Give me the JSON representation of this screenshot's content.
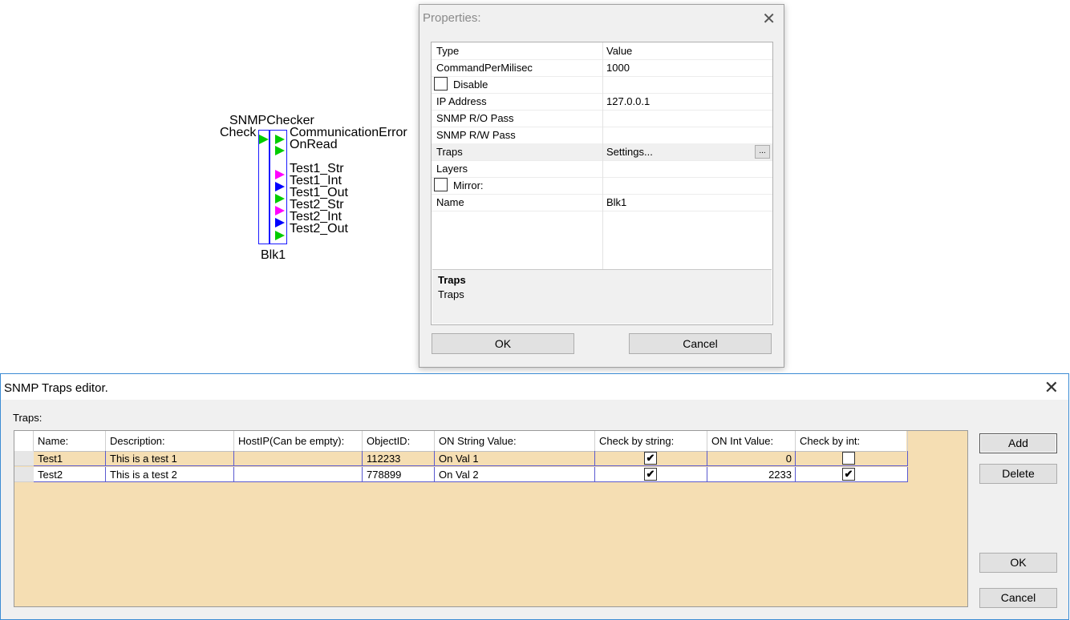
{
  "block": {
    "title": "SNMPChecker",
    "input": "Check",
    "name": "Blk1",
    "outputs": [
      {
        "label": "CommunicationError",
        "color": "#00cc00"
      },
      {
        "label": "OnRead",
        "color": "#00cc00"
      },
      {
        "label": "Test1_Str",
        "color": "#ff00ff"
      },
      {
        "label": "Test1_Int",
        "color": "#ff00ff"
      },
      {
        "label": "Test1_Out",
        "color": "#0000ff"
      },
      {
        "label": "Test2_Str",
        "color": "#00cc00"
      },
      {
        "label": "Test2_Int",
        "color": "#ff00ff"
      },
      {
        "label": "Test2_Out",
        "color": "#0000ff"
      }
    ]
  },
  "properties": {
    "title": "Properties:",
    "header_type": "Type",
    "header_value": "Value",
    "rows": [
      {
        "name": "CommandPerMilisec",
        "value": "1000"
      },
      {
        "name": "Disable",
        "value": "",
        "checkbox": true
      },
      {
        "name": "IP Address",
        "value": "127.0.0.1"
      },
      {
        "name": "SNMP R/O Pass",
        "value": ""
      },
      {
        "name": "SNMP R/W Pass",
        "value": ""
      },
      {
        "name": "Traps",
        "value": "Settings...",
        "ellipsis": "..."
      },
      {
        "name": "Layers",
        "value": ""
      },
      {
        "name": "Mirror:",
        "value": "",
        "checkbox": true
      },
      {
        "name": "Name",
        "value": "Blk1"
      }
    ],
    "description_title": "Traps",
    "description_text": "Traps",
    "ok_label": "OK",
    "cancel_label": "Cancel"
  },
  "traps_editor": {
    "title": "SNMP Traps editor.",
    "group_label": "Traps:",
    "columns": [
      "Name:",
      "Description:",
      "HostIP(Can be empty):",
      "ObjectID:",
      "ON String Value:",
      "Check by string:",
      "ON Int Value:",
      "Check by int:"
    ],
    "rows": [
      {
        "name": "Test1",
        "description": "This is a test 1",
        "host_ip": "",
        "object_id": "112233",
        "on_string": "On Val 1",
        "check_string": true,
        "on_int": "0",
        "check_int": false
      },
      {
        "name": "Test2",
        "description": "This is a test 2",
        "host_ip": "",
        "object_id": "778899",
        "on_string": "On Val 2",
        "check_string": true,
        "on_int": "2233",
        "check_int": true
      }
    ],
    "add_label": "Add",
    "delete_label": "Delete",
    "ok_label": "OK",
    "cancel_label": "Cancel",
    "check_glyph": "✔",
    "grid_color": "#f5deb3"
  }
}
